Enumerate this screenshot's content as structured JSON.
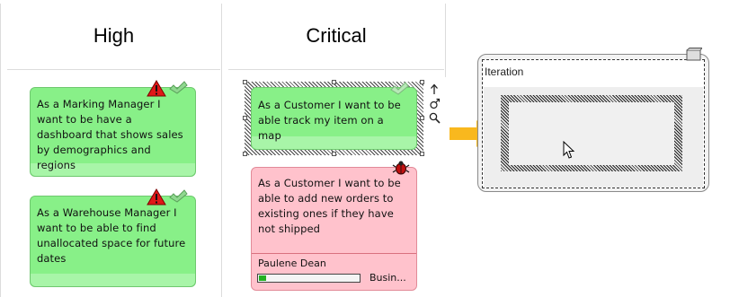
{
  "columns": [
    {
      "title": "High"
    },
    {
      "title": "Critical"
    }
  ],
  "cards": [
    {
      "text": "As a Marking Manager I want to be have a dashboard that shows sales by demographics and regions",
      "icons": [
        "warning-icon",
        "check-tick-icon"
      ]
    },
    {
      "text": "As a Warehouse Manager I want to be able to find unallocated space for future dates",
      "icons": [
        "warning-icon",
        "check-tick-icon"
      ]
    },
    {
      "text": "As a Customer I want to be able track my item on a map",
      "icons": [
        "check-tick-icon"
      ],
      "selected": true
    },
    {
      "text": "As a Customer I want to be able to add new orders to existing ones if they have not shipped",
      "icons": [
        "bug-icon"
      ],
      "assignee": "Paulene Dean",
      "category": "Busin...",
      "progress": 0.07
    }
  ],
  "quick_tools": [
    "up-arrow-icon",
    "link-connector-icon",
    "search-icon"
  ],
  "iteration": {
    "label": "Iteration"
  },
  "colors": {
    "card_green": "#88f088",
    "card_pink": "#ffc2cc",
    "arrow_orange": "#f9b81e",
    "warning_red": "#e01818"
  }
}
